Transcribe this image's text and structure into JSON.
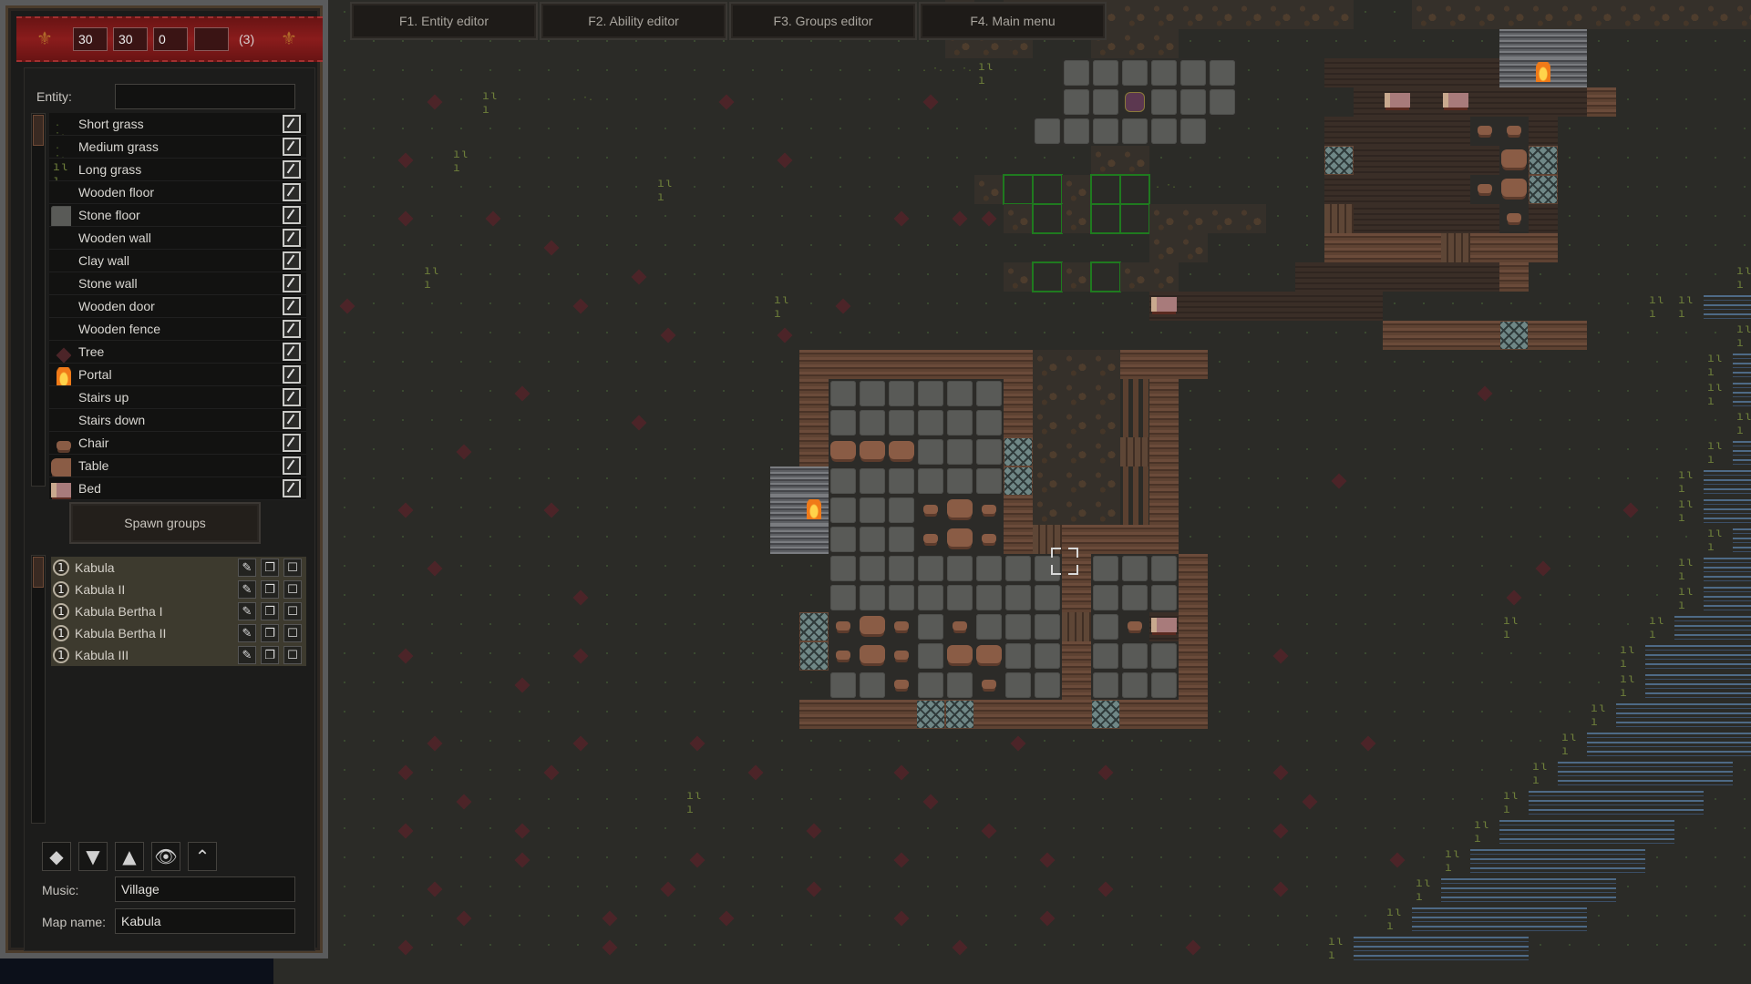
{
  "header": {
    "fields": [
      "30",
      "30",
      "0",
      ""
    ],
    "count": "(3)"
  },
  "menu": [
    {
      "label": "F1. Entity editor"
    },
    {
      "label": "F2. Ability editor"
    },
    {
      "label": "F3. Groups editor"
    },
    {
      "label": "F4. Main menu"
    }
  ],
  "entity_panel": {
    "label": "Entity:",
    "search_value": "",
    "items": [
      {
        "name": "Short grass",
        "icon": "short-grass-icon"
      },
      {
        "name": "Medium grass",
        "icon": "medium-grass-icon"
      },
      {
        "name": "Long grass",
        "icon": "long-grass-icon"
      },
      {
        "name": "Wooden floor",
        "icon": "wooden-floor-icon"
      },
      {
        "name": "Stone floor",
        "icon": "stone-floor-icon"
      },
      {
        "name": "Wooden wall",
        "icon": "wooden-wall-icon"
      },
      {
        "name": "Clay wall",
        "icon": "clay-wall-icon"
      },
      {
        "name": "Stone wall",
        "icon": "stone-wall-icon"
      },
      {
        "name": "Wooden door",
        "icon": "wooden-door-icon"
      },
      {
        "name": "Wooden fence",
        "icon": "wooden-fence-icon"
      },
      {
        "name": "Tree",
        "icon": "tree-icon"
      },
      {
        "name": "Portal",
        "icon": "portal-icon"
      },
      {
        "name": "Stairs up",
        "icon": "stairs-up-icon"
      },
      {
        "name": "Stairs down",
        "icon": "stairs-down-icon"
      },
      {
        "name": "Chair",
        "icon": "chair-icon"
      },
      {
        "name": "Table",
        "icon": "table-icon"
      },
      {
        "name": "Bed",
        "icon": "bed-icon"
      }
    ]
  },
  "spawn_groups_label": "Spawn groups",
  "groups": [
    {
      "count": "1",
      "name": "Kabula"
    },
    {
      "count": "1",
      "name": "Kabula II"
    },
    {
      "count": "1",
      "name": "Kabula Bertha I"
    },
    {
      "count": "1",
      "name": "Kabula Bertha II"
    },
    {
      "count": "1",
      "name": "Kabula III"
    }
  ],
  "tools": [
    {
      "name": "fill-bucket-icon",
      "glyph": "◆"
    },
    {
      "name": "layer-down-icon",
      "glyph": "▼"
    },
    {
      "name": "layer-up-icon",
      "glyph": "▲"
    },
    {
      "name": "roof-visibility-icon",
      "glyph": "👁"
    },
    {
      "name": "roof-icon",
      "glyph": "⌃"
    }
  ],
  "settings": {
    "music_label": "Music:",
    "music_value": "Village",
    "map_name_label": "Map name:",
    "map_name_value": "Kabula"
  },
  "map": {
    "legend": {
      ".": "ground",
      "t": "tree",
      "g": "long-grass",
      "s": "short-grass",
      "d": "dirt",
      "W": "wooden-wall",
      "f": "wooden-floor",
      "S": "stone-floor",
      "C": "stone-wall",
      "X": "window",
      "D": "wooden-door",
      "F": "wooden-fence",
      "T": "table",
      "c": "chair",
      "B": "bed",
      "P": "portal",
      "w": "water",
      "p": "pot",
      "G": "selected"
    },
    "rows": [
      ".....................d.dddddddddddd..ddddddddddddddddddddddddd",
      ".....................ddd..ddd...........CCC.......g.gFFFFF...",
      "....................ssg..SSSSSS...ffffffCPC.......g.gwww.t..",
      "...t.g..s....t......t....SSpSSS....fBfBffffW.......gwwww....",
      "........................SSSSSS....fffffccf........gwwww..t.t",
      "..t.g..........t..........dd......XfffffTX.......gggwwww.t..",
      "...........g..........dGGdGGs.....fffffcTX.......ggwwwwg....",
      "..t..t.............t.ttdGdGGdddd..Dfffffcf........gwwww.....",
      ".......t....................dd....WWWWDWWW.......gwwwwww....",
      "...g......t............dGdGdd....fffffffW.......gwwwww......",
      "t.......t......g.t..........Bfffffff.........ggwwwwww..t....",
      "...........t...t....................WWWWXWW.....gwwwwww.....",
      "................WWWWWWWWdddWWW.................gwwwwww......",
      "......t.........WSSSSSSWdddFW..........t.......gwwwwwww.t...",
      "..........t.....WSSSSSSWdddFW...................gwwwwwww....",
      "....t...........WTTTSSSXdddDW..................gwwwwww......",
      "...............CCSSSSSSXdddFW.....t...........gwwwwww.......",
      "..t....t.......CPSSScTcWdddFW...............t.gwwwwww....t..",
      "...............CCSSScTcWDWWWW..................gwwwwww......",
      "...t.............SSSSSSSSWSSSW...........t....gwwwwww.......",
      "........t........SSSSSSSSWSSSW..........t.....gwwwwww....t..",
      "................XcTcScSSSDScBW..........g....gwwwwww........",
      "..t.....t.......XcTcSTTSSWSSSW..t...........gwwwwww.........",
      "......t..........SScSScSSWSSSW..............gwwwwww.....t...",
      "................WWWWXXWWWWXWWW.............gwwwwww..........",
      "...t....t...t..........t...........t......gwwwwww...........",
      "..t....t......t....t......t.....t........gwwwwww......t.....",
      "....t.......g.......t............t......gwwwwww.............",
      "..t...t.........t.....t.........t......gwwwwww..........t...",
      "......t.....t......t....t...........t.gwwwwww...............",
      "...t.......t....t.........t.....t....gwwwwww.........t......",
      "....t....t...t.....t....t...........gwwwwww..........t......",
      "..t......t...........t.......t....gwwwwww..................."
    ]
  }
}
